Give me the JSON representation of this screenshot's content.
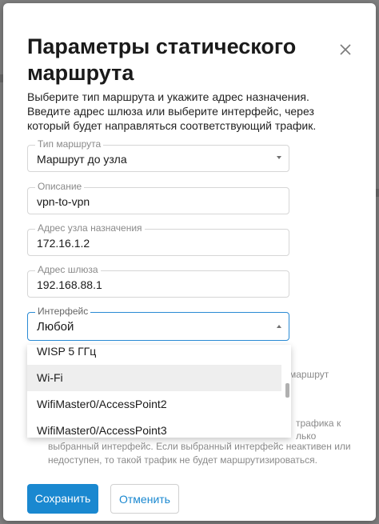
{
  "dialog": {
    "title": "Параметры статического маршрута",
    "description": "Выберите тип маршрута и укажите адрес назначения. Введите адрес шлюза или выберите интерфейс, через который будет направляться соответствующий трафик."
  },
  "fields": {
    "route_type": {
      "label": "Тип маршрута",
      "value": "Маршрут до узла"
    },
    "description": {
      "label": "Описание",
      "value": "vpn-to-vpn"
    },
    "destination": {
      "label": "Адрес узла назначения",
      "value": "172.16.1.2"
    },
    "gateway": {
      "label": "Адрес шлюза",
      "value": "192.168.88.1"
    },
    "interface": {
      "label": "Интерфейс",
      "value": "Любой"
    }
  },
  "dropdown": {
    "items": [
      "WISP 5 ГГц",
      "Wi-Fi",
      "WifiMaster0/AccessPoint2",
      "WifiMaster0/AccessPoint3"
    ]
  },
  "hidden_text": {
    "line1": "маршрут",
    "line2": "трафика к",
    "line3": "лько",
    "line4": "выбранный интерфейс. Если выбранный интерфейс неактивен или",
    "line5": "недоступен, то такой трафик не будет маршрутизироваться."
  },
  "buttons": {
    "save": "Сохранить",
    "cancel": "Отменить"
  },
  "colors": {
    "accent": "#1a88d0",
    "focus": "#2a8ad4"
  }
}
